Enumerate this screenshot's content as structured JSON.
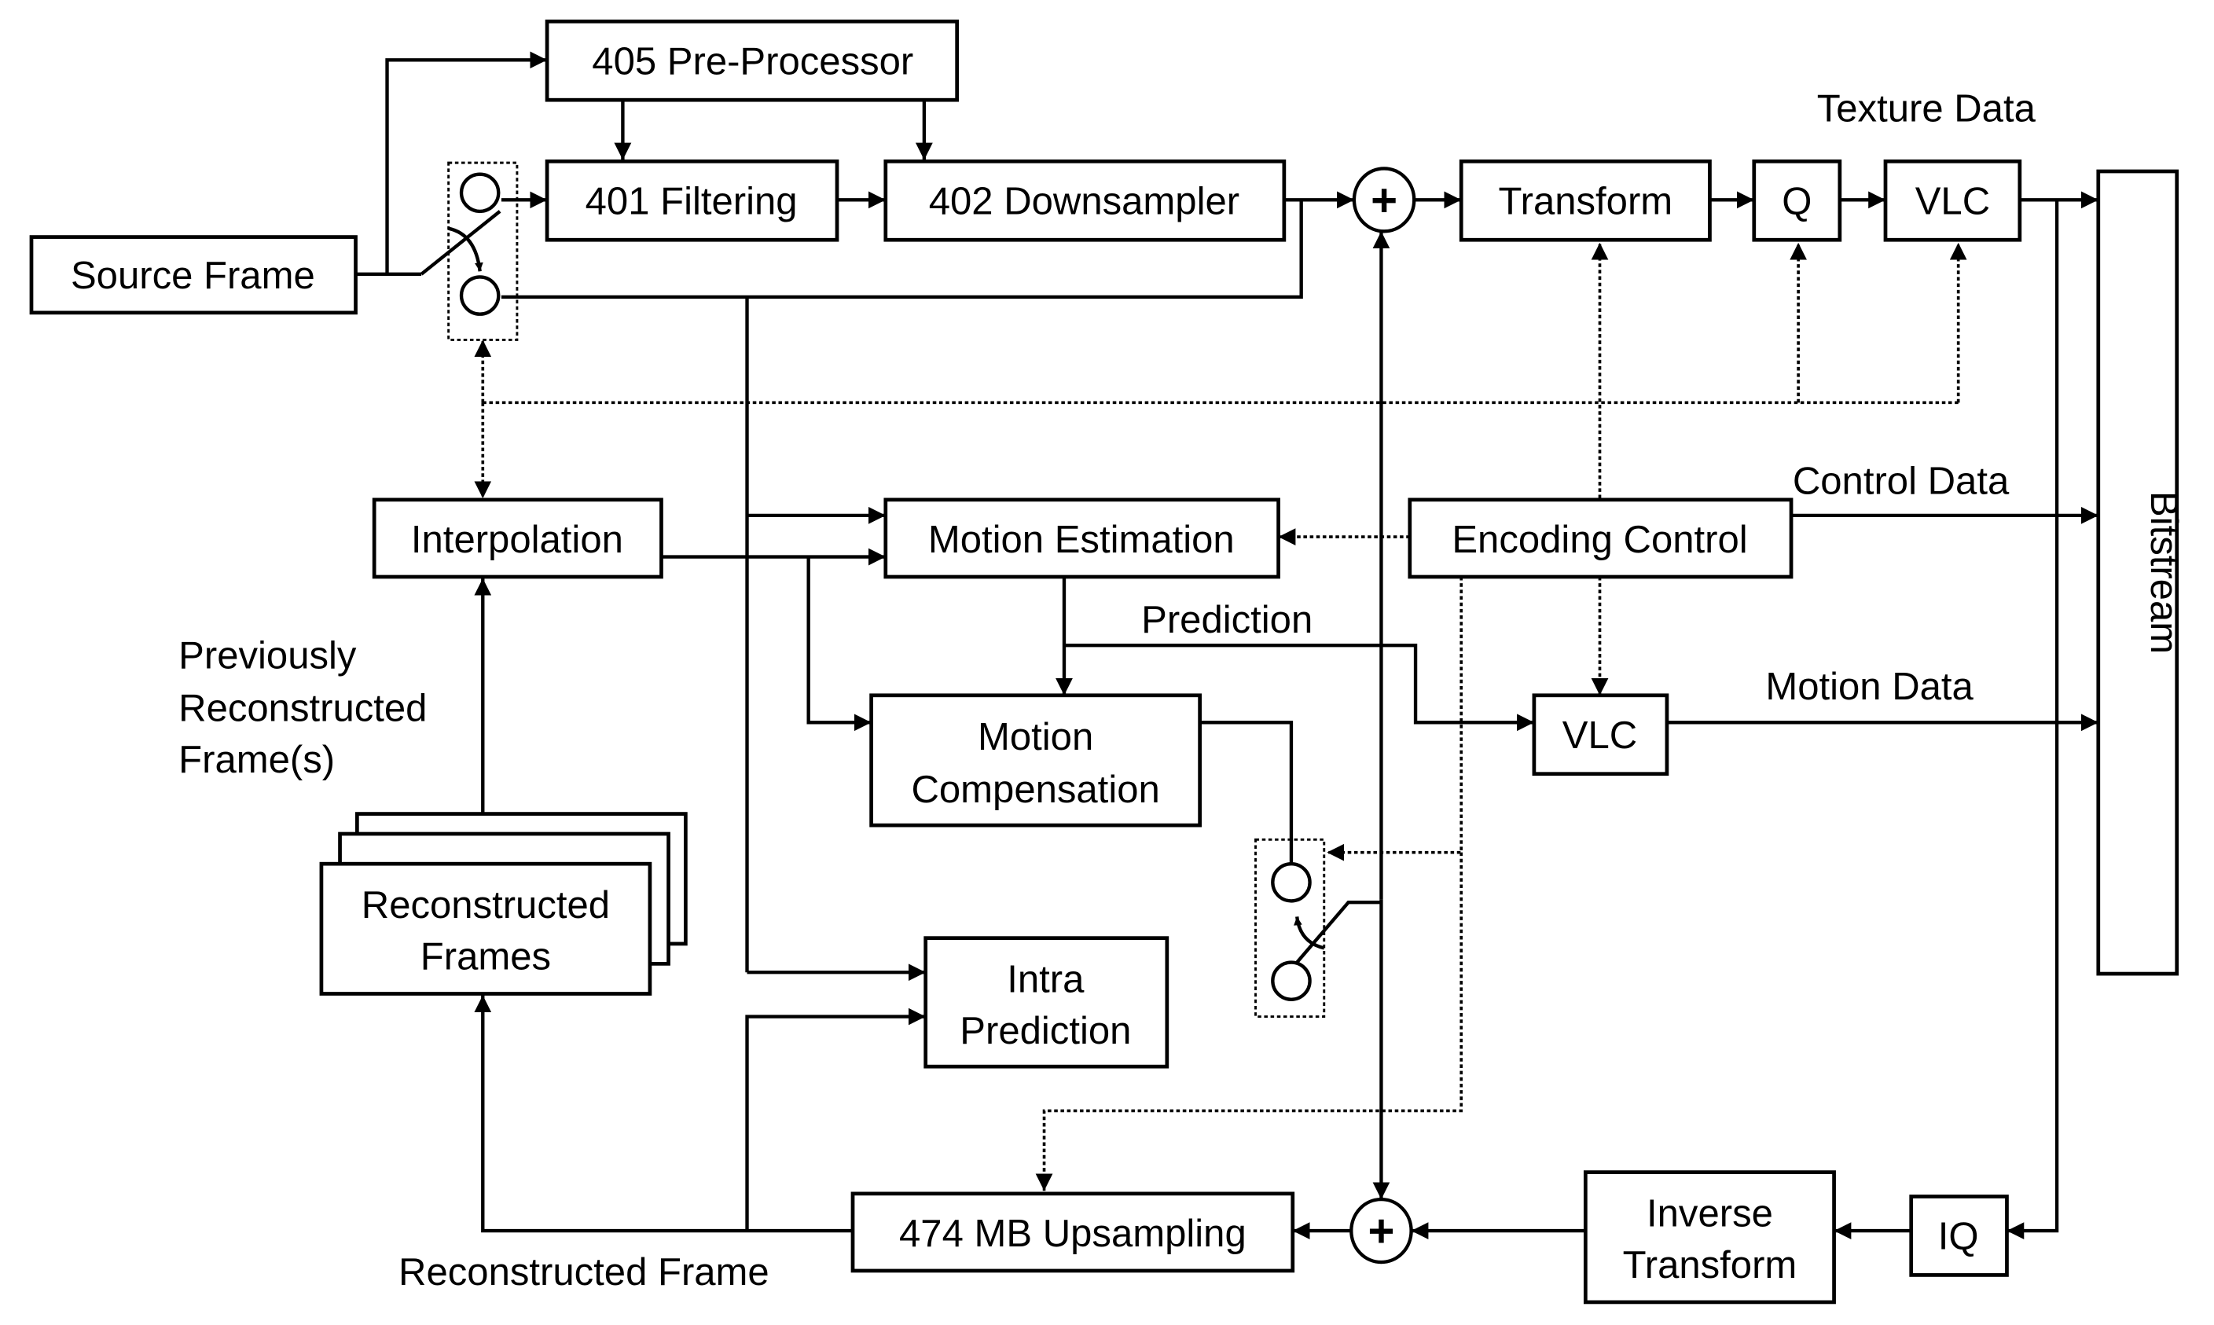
{
  "diagram": {
    "type": "video encoder block diagram",
    "blocks": {
      "source_frame": "Source Frame",
      "pre_processor": "405 Pre-Processor",
      "filtering": "401 Filtering",
      "downsampler": "402 Downsampler",
      "transform": "Transform",
      "quantizer": "Q",
      "vlc_texture": "VLC",
      "bitstream": "Bitstream",
      "interpolation": "Interpolation",
      "motion_estimation": "Motion Estimation",
      "encoding_control": "Encoding Control",
      "motion_compensation_line1": "Motion",
      "motion_compensation_line2": "Compensation",
      "vlc_motion": "VLC",
      "reconstructed_frames_line1": "Reconstructed",
      "reconstructed_frames_line2": "Frames",
      "intra_prediction_line1": "Intra",
      "intra_prediction_line2": "Prediction",
      "mb_upsampling": "474 MB Upsampling",
      "inverse_transform_line1": "Inverse",
      "inverse_transform_line2": "Transform",
      "inverse_quantizer": "IQ"
    },
    "labels": {
      "texture_data": "Texture Data",
      "control_data": "Control Data",
      "motion_data": "Motion Data",
      "prediction": "Prediction",
      "previously_line1": "Previously",
      "previously_line2": "Reconstructed",
      "previously_line3": "Frame(s)",
      "reconstructed_frame": "Reconstructed Frame"
    },
    "summing_node_symbol": "+"
  }
}
